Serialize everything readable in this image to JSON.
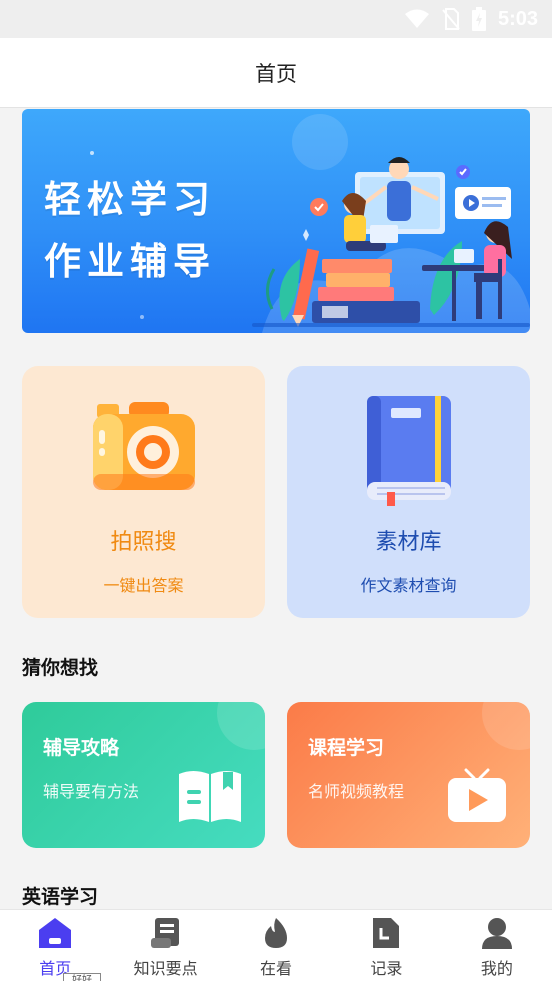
{
  "status_bar": {
    "time": "5:03"
  },
  "header": {
    "title": "首页"
  },
  "banner": {
    "line1": "轻松学习",
    "line2": "作业辅导"
  },
  "features": [
    {
      "title": "拍照搜",
      "subtitle": "一键出答案",
      "icon": "camera-icon"
    },
    {
      "title": "素材库",
      "subtitle": "作文素材查询",
      "icon": "book-icon"
    }
  ],
  "sections": {
    "guess": "猜你想找",
    "english": "英语学习"
  },
  "tiles": [
    {
      "title": "辅导攻略",
      "subtitle": "辅导要有方法",
      "icon": "open-book-icon",
      "colors": [
        "#2fcb9a",
        "#46dcc0"
      ]
    },
    {
      "title": "课程学习",
      "subtitle": "名师视频教程",
      "icon": "tv-play-icon",
      "colors": [
        "#fb7b48",
        "#ffb178"
      ]
    }
  ],
  "tabbar": {
    "active_color": "#4b3ef0",
    "items": [
      {
        "label": "首页",
        "icon": "home-icon",
        "active": true
      },
      {
        "label": "知识要点",
        "icon": "scroll-icon",
        "active": false
      },
      {
        "label": "在看",
        "icon": "flame-icon",
        "active": false
      },
      {
        "label": "记录",
        "icon": "document-icon",
        "active": false
      },
      {
        "label": "我的",
        "icon": "user-icon",
        "active": false
      }
    ],
    "badge": "好好"
  }
}
